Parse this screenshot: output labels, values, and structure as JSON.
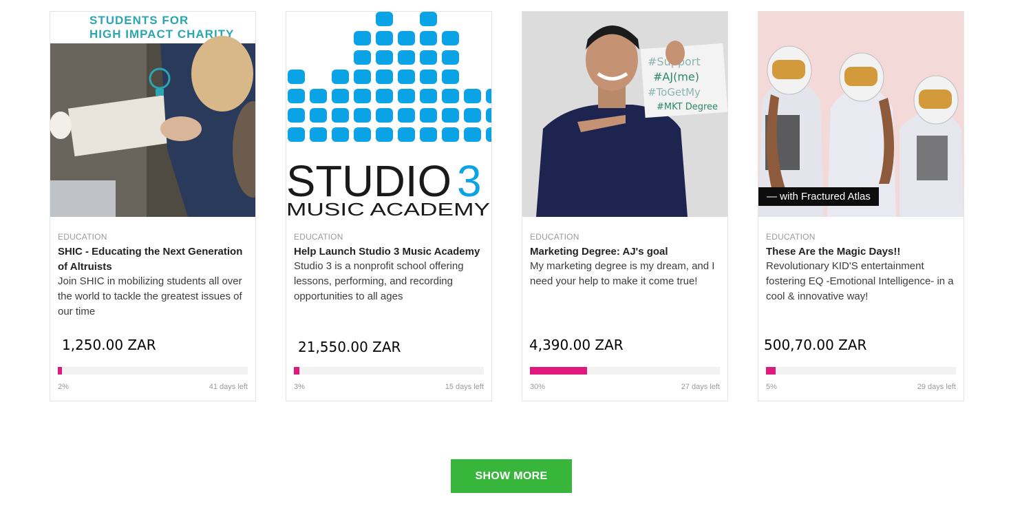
{
  "campaigns": [
    {
      "category": "EDUCATION",
      "title": "SHIC - Educating the Next Generation of Altruists",
      "description": "Join SHIC in mobilizing students all over the world to tackle the greatest issues of our time",
      "raised": "1,250.00 ZAR",
      "percent_label": "2%",
      "progress_fraction": 0.02,
      "days_left": "41 days left",
      "image_text": [
        "STUDENTS FOR",
        "HIGH IMPACT CHARITY"
      ]
    },
    {
      "category": "EDUCATION",
      "title": "Help Launch Studio 3 Music Academy",
      "description": "Studio 3 is a nonprofit school offering lessons, performing, and recording opportunities to all ages",
      "raised": "21,550.00 ZAR",
      "percent_label": "3%",
      "progress_fraction": 0.03,
      "days_left": "15 days left",
      "image_text": [
        "STUDIO",
        "3",
        "MUSIC ACADEMY"
      ]
    },
    {
      "category": "EDUCATION",
      "title": "Marketing Degree: AJ's goal",
      "description": "My marketing degree is my dream, and I need your help to make it come true!",
      "raised": "4,390.00 ZAR",
      "percent_label": "30%",
      "progress_fraction": 0.3,
      "days_left": "27 days left",
      "image_text": [
        "#Support",
        "#AJ(me)",
        "#ToGetMy",
        "#MKT Degree"
      ]
    },
    {
      "category": "EDUCATION",
      "title": "These Are the Magic Days!!",
      "description": "Revolutionary KID'S entertainment fostering EQ -Emotional Intelligence- in a cool & innovative way!",
      "raised": "500,70.00 ZAR",
      "percent_label": "5%",
      "progress_fraction": 0.05,
      "days_left": "29 days left",
      "image_badge": "— with Fractured Atlas"
    }
  ],
  "show_more_label": "SHOW MORE",
  "colors": {
    "progress": "#e0197d",
    "button": "#38b63b",
    "studio_blue": "#0aa3e6",
    "shic_teal": "#2aa6b3"
  }
}
